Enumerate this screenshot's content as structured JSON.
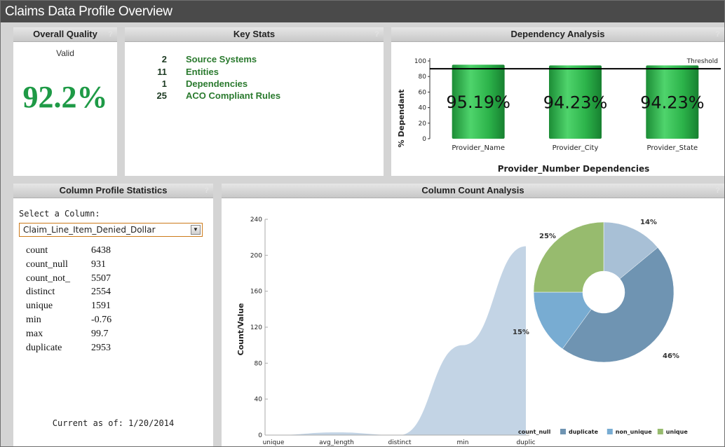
{
  "window": {
    "title": "Claims Data Profile Overview"
  },
  "overall_quality": {
    "header": "Overall Quality",
    "help": "?",
    "label": "Valid",
    "value": "92.2%"
  },
  "key_stats": {
    "header": "Key Stats",
    "help": "?",
    "items": [
      {
        "number": "2",
        "label": "Source Systems"
      },
      {
        "number": "11",
        "label": "Entities"
      },
      {
        "number": "1",
        "label": "Dependencies"
      },
      {
        "number": "25",
        "label": "ACO Compliant Rules"
      }
    ]
  },
  "dependency_analysis": {
    "header": "Dependency Analysis",
    "help": "?",
    "chart_data": {
      "type": "bar",
      "categories": [
        "Provider_Name",
        "Provider_City",
        "Provider_State"
      ],
      "values": [
        95.19,
        94.23,
        94.23
      ],
      "data_labels": [
        "95.19%",
        "94.23%",
        "94.23%"
      ],
      "xlabel": "Provider_Number Dependencies",
      "ylabel": "% Dependant",
      "ylim": [
        0,
        100
      ],
      "yticks": [
        "0",
        "20",
        "40",
        "60",
        "80",
        "100"
      ],
      "threshold": {
        "label": "Threshold",
        "value": 90
      },
      "bar_color": "#2cb34a"
    }
  },
  "column_profile": {
    "header": "Column Profile Statistics",
    "help": "?",
    "select_label": "Select a Column:",
    "selected_column": "Claim_Line_Item_Denied_Dollar",
    "stats": [
      {
        "name": "count",
        "value": "6438"
      },
      {
        "name": "count_null",
        "value": "931"
      },
      {
        "name": "count_not_",
        "value": "5507"
      },
      {
        "name": "distinct",
        "value": "2554"
      },
      {
        "name": "unique",
        "value": "1591"
      },
      {
        "name": "min",
        "value": "-0.76"
      },
      {
        "name": "max",
        "value": "99.7"
      },
      {
        "name": "duplicate",
        "value": "2953"
      }
    ],
    "current_as_of": "Current as of: 1/20/2014"
  },
  "column_count": {
    "header": "Column Count Analysis",
    "help": "?",
    "chart_data": [
      {
        "type": "area",
        "categories": [
          "unique",
          "avg_length",
          "distinct",
          "min",
          "duplic"
        ],
        "values": [
          0,
          3,
          0,
          100,
          210
        ],
        "ylabel": "Count/Value",
        "ylim": [
          0,
          240
        ],
        "yticks": [
          "0",
          "40",
          "80",
          "120",
          "160",
          "200",
          "240"
        ],
        "color": "#b8cce0"
      },
      {
        "type": "pie",
        "labels": [
          "count_null",
          "duplicate",
          "non_unique",
          "unique"
        ],
        "values": [
          14,
          46,
          15,
          25
        ],
        "data_labels": [
          "14%",
          "46%",
          "15%",
          "25%"
        ],
        "colors": [
          "#a8c0d6",
          "#6f94b2",
          "#78acd2",
          "#97bb6e"
        ],
        "legend_position": "bottom"
      }
    ]
  }
}
